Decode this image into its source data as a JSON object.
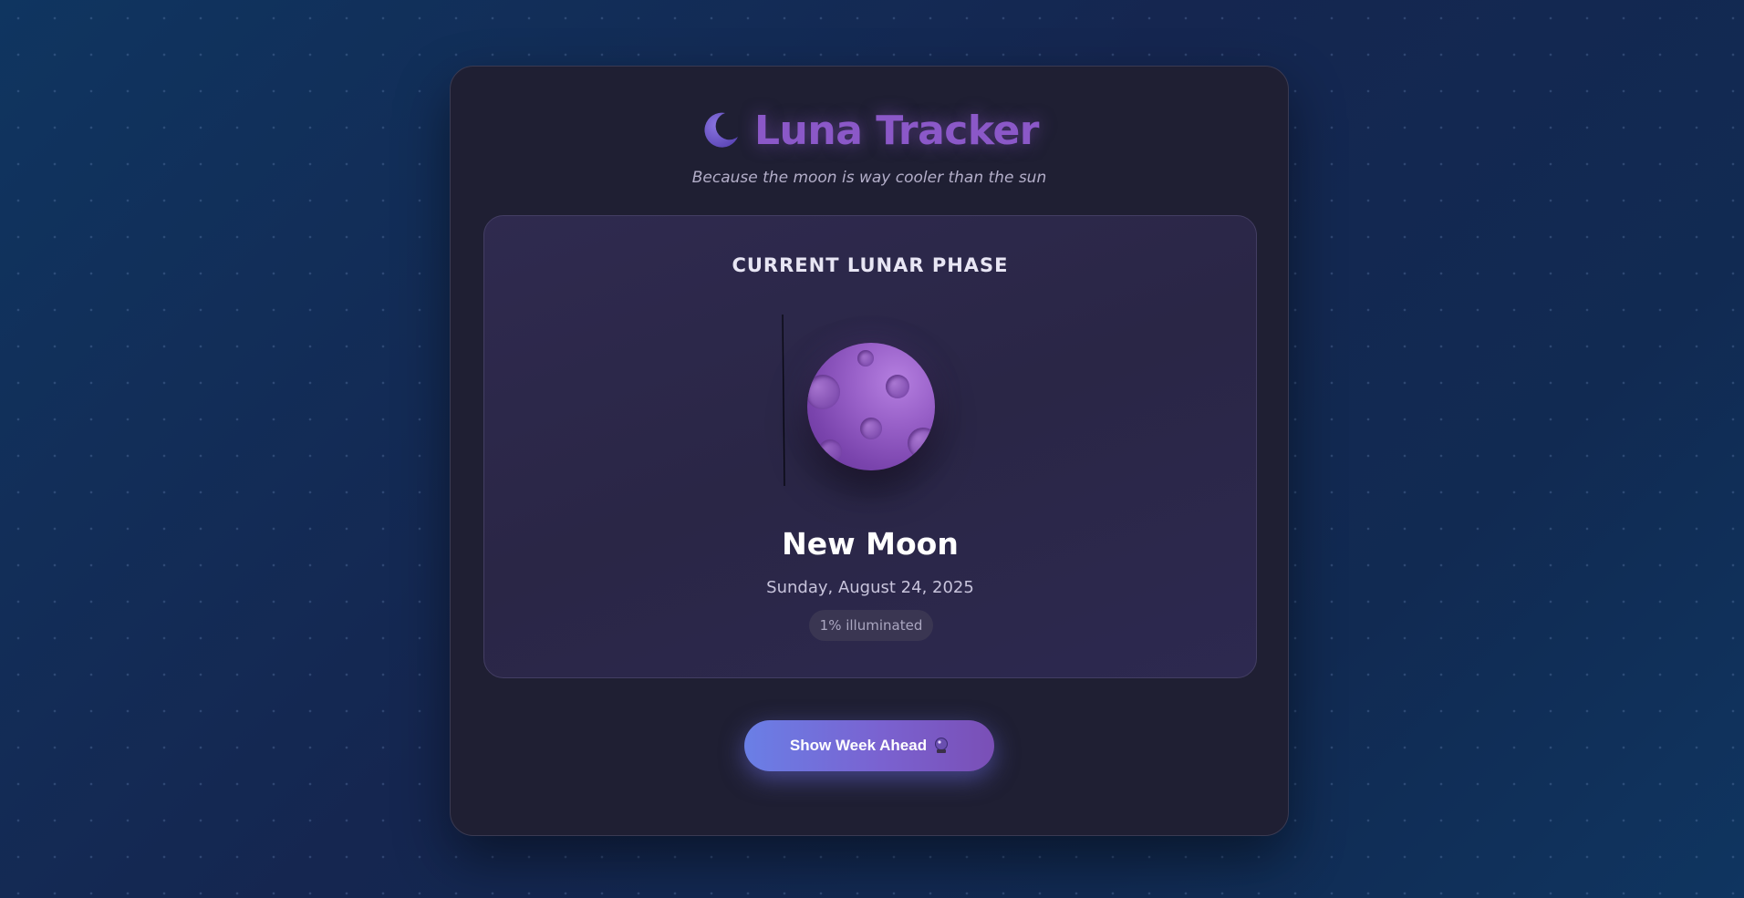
{
  "app": {
    "title": "Luna Tracker",
    "subtitle": "Because the moon is way cooler than the sun",
    "title_icon": "crescent-moon-icon"
  },
  "phase_panel": {
    "heading": "CURRENT LUNAR PHASE",
    "phase_name": "New Moon",
    "date": "Sunday, August 24, 2025",
    "illumination_label": "1% illuminated",
    "illumination_fraction": 0.01
  },
  "actions": {
    "week_button_label": "Show Week Ahead",
    "week_button_icon": "crystal-ball-icon"
  },
  "colors": {
    "accent": "#8b58c8",
    "button_start": "#6a7fe6",
    "button_end": "#7a4fb6",
    "panel_bg": "#2c2849",
    "card_bg": "#1f1f33"
  }
}
